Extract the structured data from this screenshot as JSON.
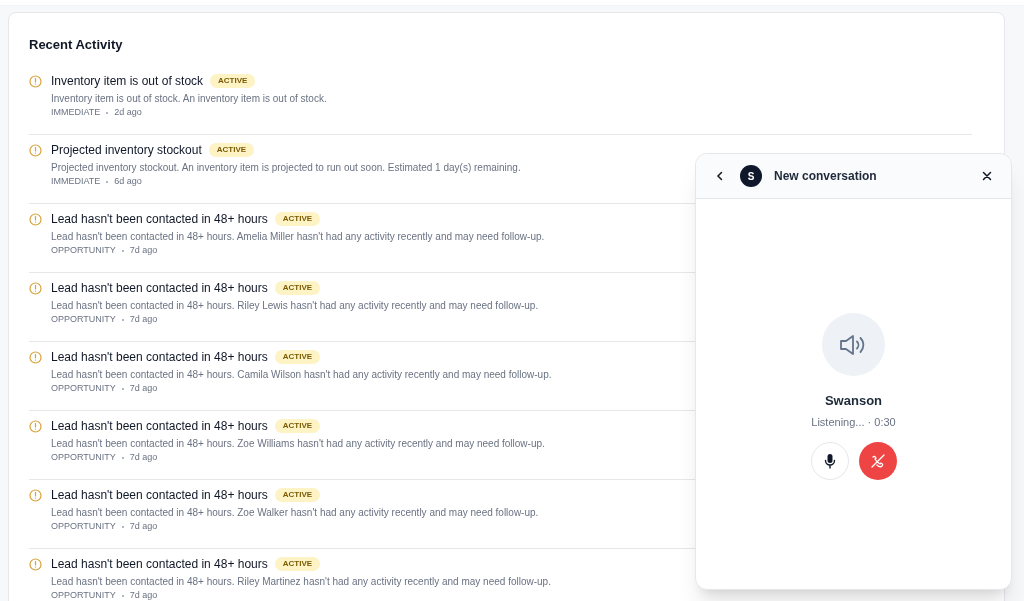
{
  "panel": {
    "title": "Recent Activity",
    "items": [
      {
        "title": "Inventory item is out of stock",
        "badge": "ACTIVE",
        "description": "Inventory item is out of stock. An inventory item is out of stock.",
        "category": "IMMEDIATE",
        "time": "2d ago"
      },
      {
        "title": "Projected inventory stockout",
        "badge": "ACTIVE",
        "description": "Projected inventory stockout. An inventory item is projected to run out soon. Estimated 1 day(s) remaining.",
        "category": "IMMEDIATE",
        "time": "6d ago"
      },
      {
        "title": "Lead hasn't been contacted in 48+ hours",
        "badge": "ACTIVE",
        "description": "Lead hasn't been contacted in 48+ hours. Amelia Miller hasn't had any activity recently and may need follow-up.",
        "category": "OPPORTUNITY",
        "time": "7d ago"
      },
      {
        "title": "Lead hasn't been contacted in 48+ hours",
        "badge": "ACTIVE",
        "description": "Lead hasn't been contacted in 48+ hours. Riley Lewis hasn't had any activity recently and may need follow-up.",
        "category": "OPPORTUNITY",
        "time": "7d ago"
      },
      {
        "title": "Lead hasn't been contacted in 48+ hours",
        "badge": "ACTIVE",
        "description": "Lead hasn't been contacted in 48+ hours. Camila Wilson hasn't had any activity recently and may need follow-up.",
        "category": "OPPORTUNITY",
        "time": "7d ago"
      },
      {
        "title": "Lead hasn't been contacted in 48+ hours",
        "badge": "ACTIVE",
        "description": "Lead hasn't been contacted in 48+ hours. Zoe Williams hasn't had any activity recently and may need follow-up.",
        "category": "OPPORTUNITY",
        "time": "7d ago"
      },
      {
        "title": "Lead hasn't been contacted in 48+ hours",
        "badge": "ACTIVE",
        "description": "Lead hasn't been contacted in 48+ hours. Zoe Walker hasn't had any activity recently and may need follow-up.",
        "category": "OPPORTUNITY",
        "time": "7d ago"
      },
      {
        "title": "Lead hasn't been contacted in 48+ hours",
        "badge": "ACTIVE",
        "description": "Lead hasn't been contacted in 48+ hours. Riley Martinez hasn't had any activity recently and may need follow-up.",
        "category": "OPPORTUNITY",
        "time": "7d ago"
      }
    ]
  },
  "call_widget": {
    "avatar": "S",
    "title": "New conversation",
    "caller": "Swanson",
    "status": "Listening... · 0:30"
  }
}
